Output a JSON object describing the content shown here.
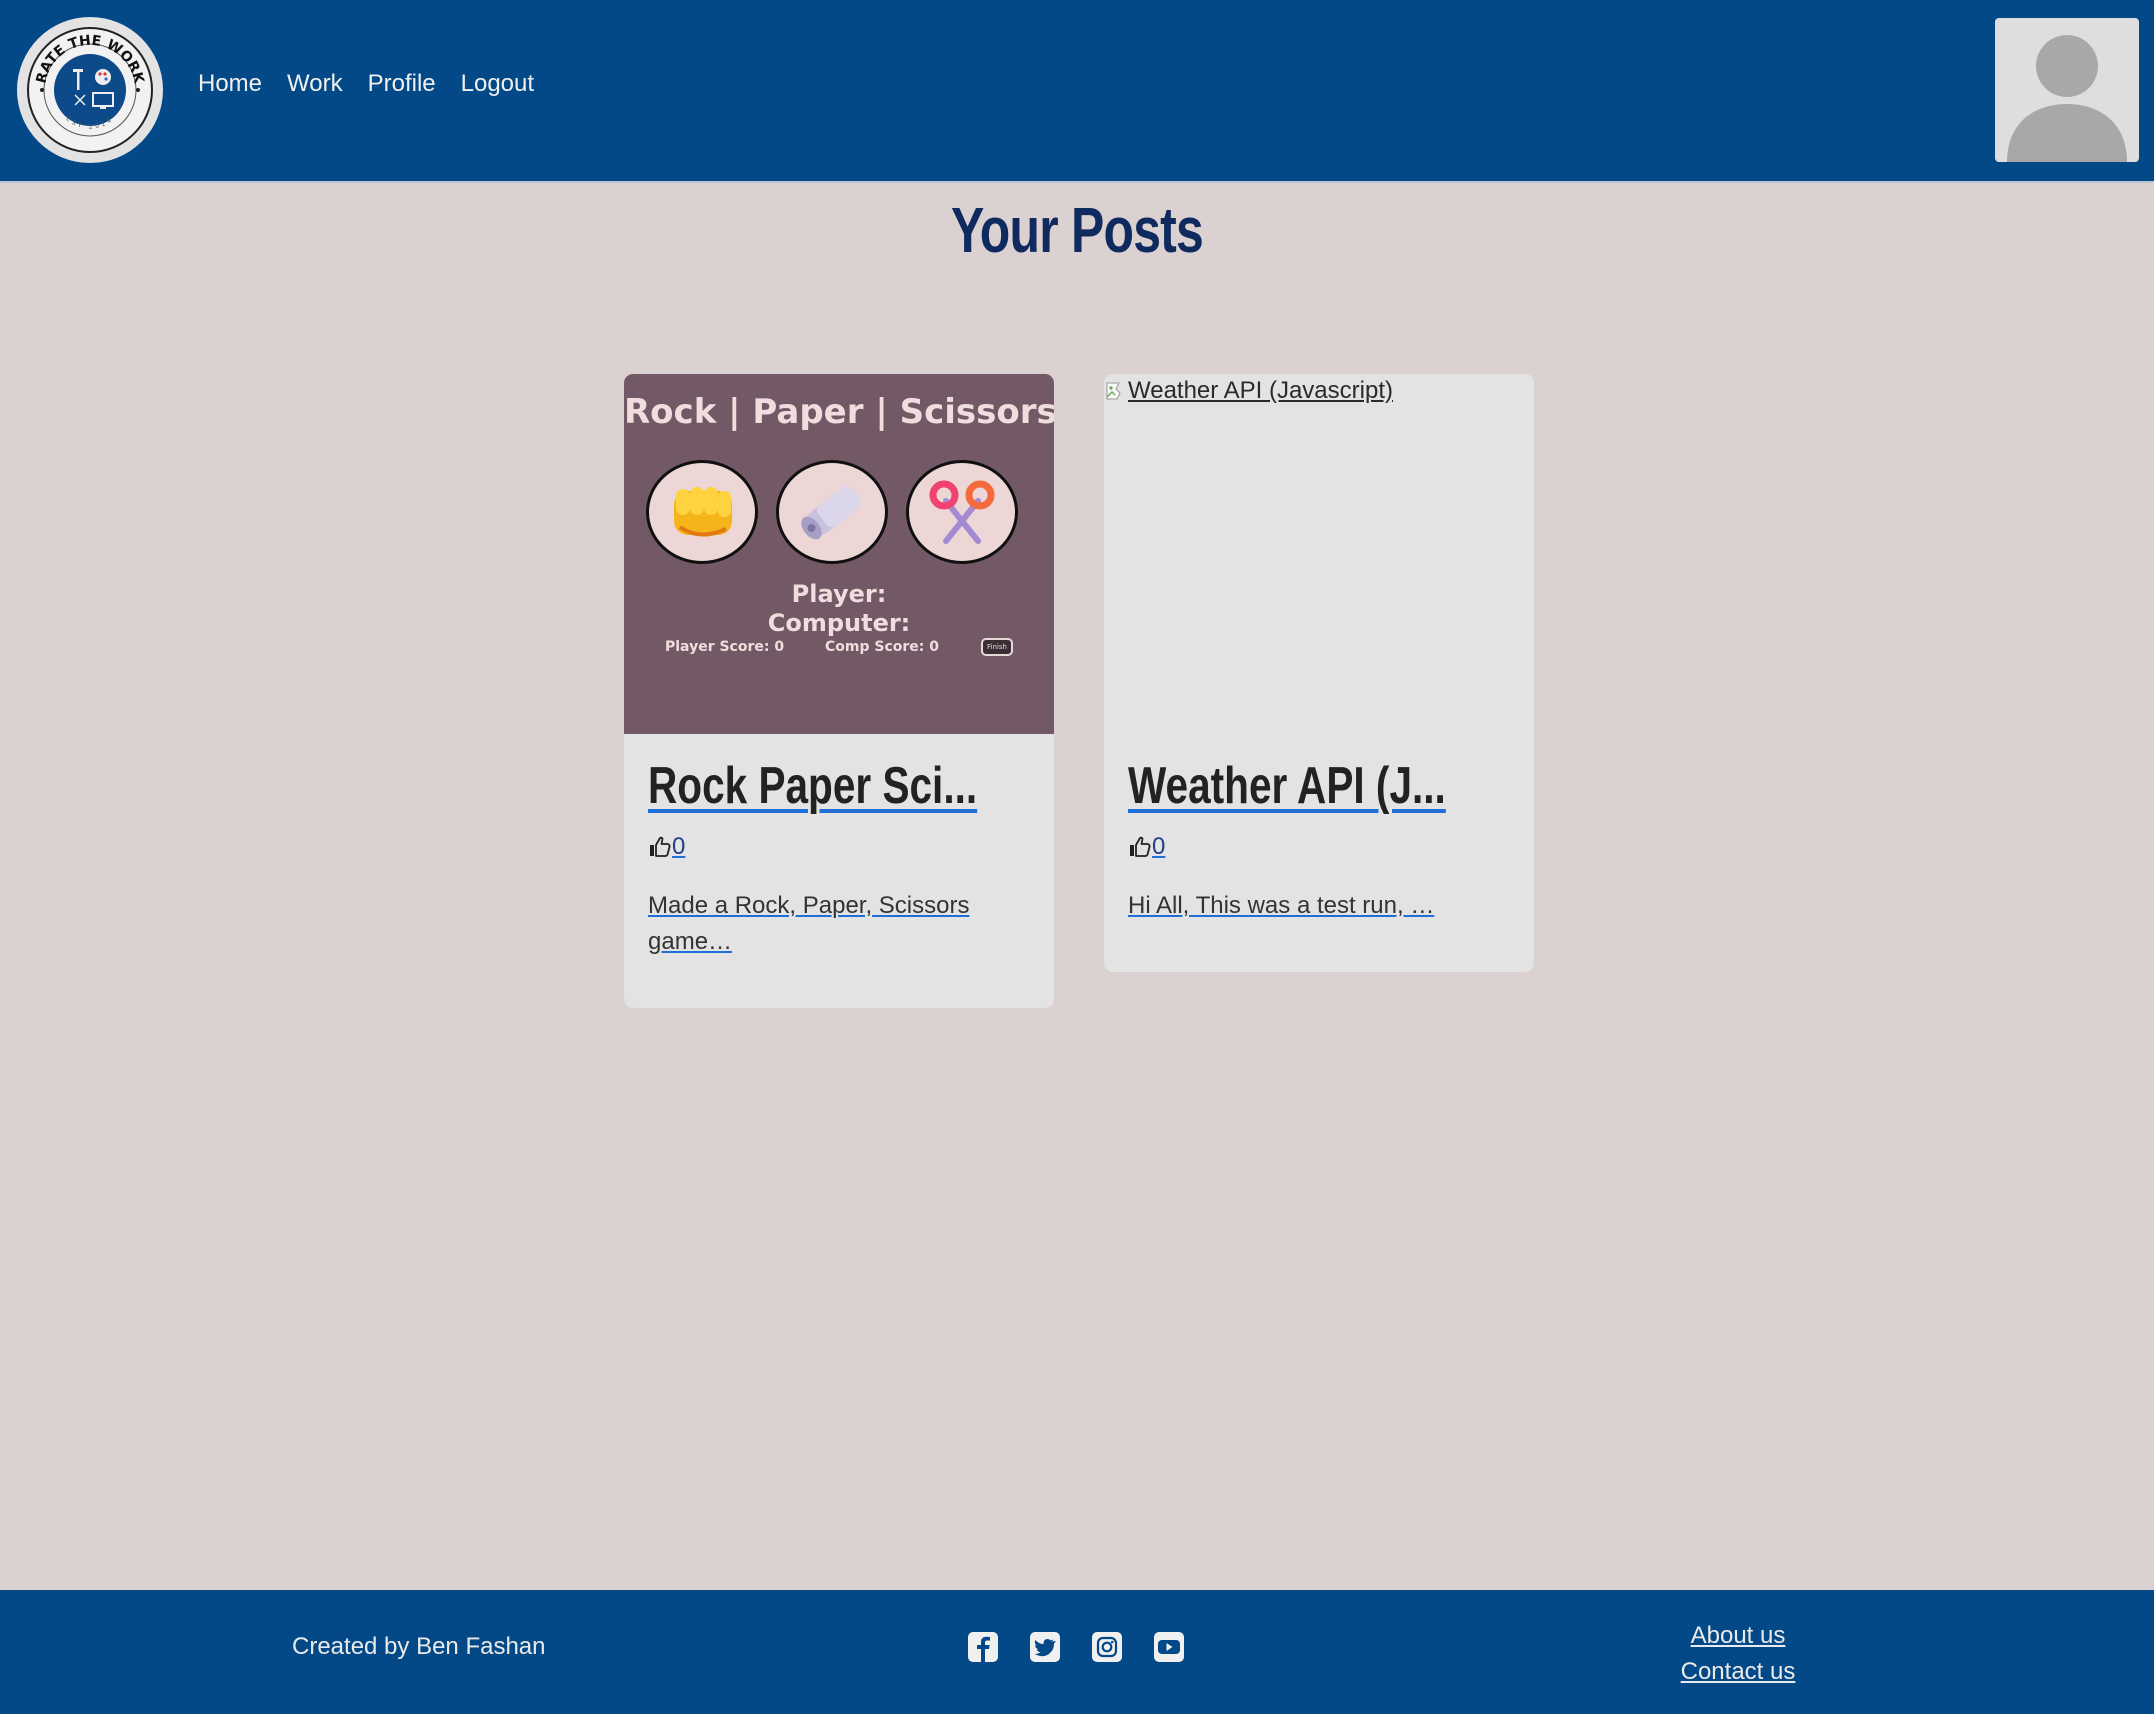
{
  "header": {
    "logo_text": "RATE THE WORK",
    "logo_est": "EST 2024",
    "nav": [
      "Home",
      "Work",
      "Profile",
      "Logout"
    ],
    "avatar_icon": "user-avatar-icon"
  },
  "main": {
    "title": "Your Posts",
    "cards": [
      {
        "thumb": {
          "title": "Rock | Paper | Scissors",
          "player_label": "Player:",
          "computer_label": "Computer:",
          "player_score": "Player Score: 0",
          "comp_score": "Comp Score: 0",
          "finish_label": "Finish"
        },
        "title": "Rock Paper Sci...",
        "likes": "0",
        "excerpt": "Made a Rock, Paper, Scissors game…"
      },
      {
        "thumb_alt": "Weather API (Javascript)",
        "title": "Weather API (J...",
        "likes": "0",
        "excerpt": "Hi All, This was a test run, …"
      }
    ]
  },
  "footer": {
    "credit": "Created by Ben Fashan",
    "socials": [
      "facebook-icon",
      "twitter-icon",
      "instagram-icon",
      "youtube-icon"
    ],
    "links": [
      "About us",
      "Contact us"
    ]
  },
  "colors": {
    "header_bg": "#044987",
    "page_bg": "#dbd1d1",
    "title": "#0e2a5e",
    "card_bg": "#e3e3e3",
    "rps_bg": "#735866"
  }
}
